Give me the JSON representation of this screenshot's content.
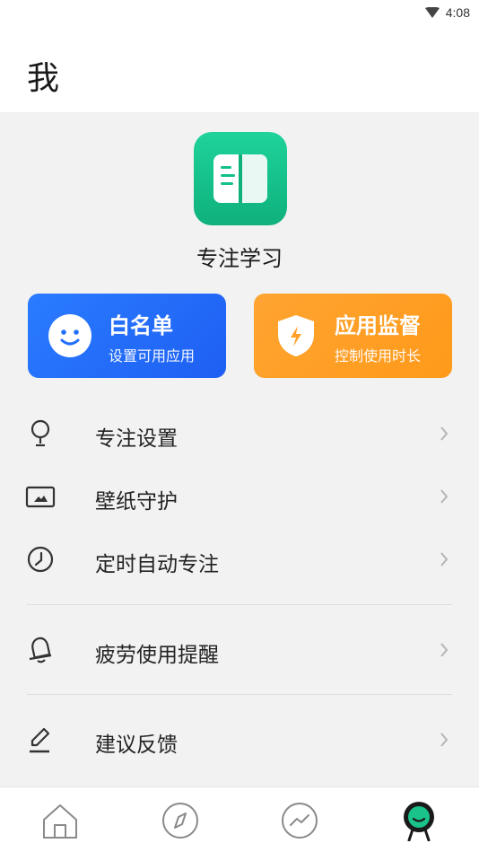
{
  "status_bar": {
    "time": "4:08",
    "wifi_icon": "wifi-icon"
  },
  "header": {
    "title": "我"
  },
  "profile": {
    "app_name": "专注学习",
    "icon": "book-icon",
    "icon_colors": [
      "#1ed39a",
      "#0fb07c"
    ]
  },
  "cards": [
    {
      "title": "白名单",
      "subtitle": "设置可用应用",
      "icon": "smile-icon",
      "color": "#2170fb"
    },
    {
      "title": "应用监督",
      "subtitle": "控制使用时长",
      "icon": "shield-bolt-icon",
      "color": "#ffa02a"
    }
  ],
  "menu": [
    {
      "label": "专注设置",
      "icon": "lightbulb-icon"
    },
    {
      "label": "壁纸守护",
      "icon": "image-icon"
    },
    {
      "label": "定时自动专注",
      "icon": "clock-icon"
    },
    {
      "label": "疲劳使用提醒",
      "icon": "bell-icon"
    },
    {
      "label": "建议反馈",
      "icon": "pencil-icon"
    }
  ],
  "tabbar": {
    "tabs": [
      "home-icon",
      "compass-icon",
      "trend-icon",
      "profile-icon"
    ],
    "active_index": 3,
    "active_color": "#19c389"
  }
}
